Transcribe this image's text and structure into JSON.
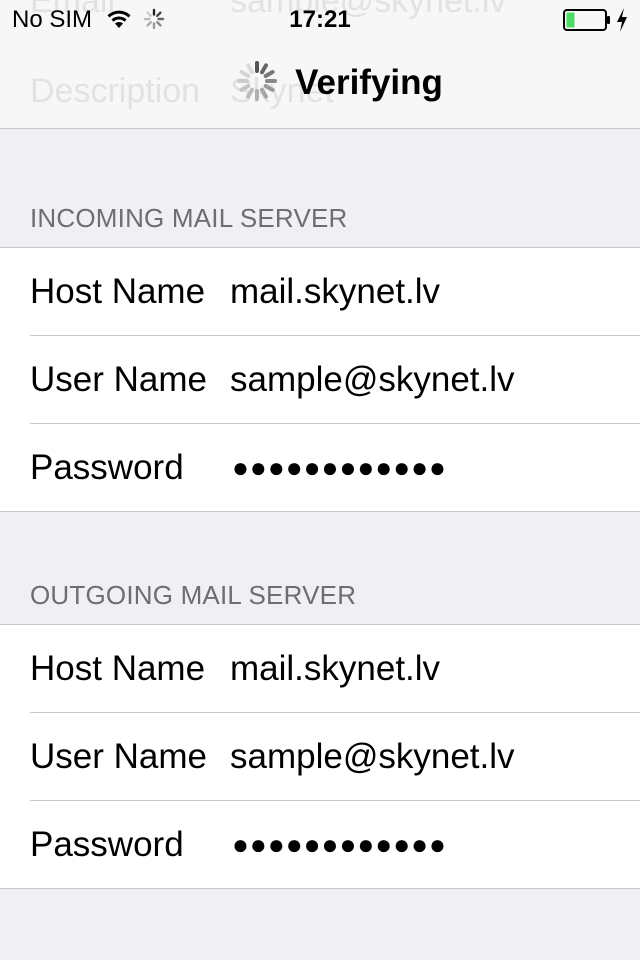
{
  "status_bar": {
    "carrier": "No SIM",
    "time": "17:21",
    "battery_color": "#4cd964",
    "icons": [
      "wifi-icon",
      "activity-spinner-icon",
      "battery-icon",
      "charging-bolt-icon"
    ]
  },
  "nav": {
    "title": "Verifying",
    "icon": "activity-spinner-icon"
  },
  "background_rows": {
    "email_label": "Email",
    "email_value": "sample@skynet.lv",
    "description_label": "Description",
    "description_value": "Skynet"
  },
  "incoming": {
    "header": "INCOMING MAIL SERVER",
    "host_label": "Host Name",
    "host_value": "mail.skynet.lv",
    "user_label": "User Name",
    "user_value": "sample@skynet.lv",
    "password_label": "Password",
    "password_value": "●●●●●●●●●●●●"
  },
  "outgoing": {
    "header": "OUTGOING MAIL SERVER",
    "host_label": "Host Name",
    "host_value": "mail.skynet.lv",
    "user_label": "User Name",
    "user_value": "sample@skynet.lv",
    "password_label": "Password",
    "password_value": "●●●●●●●●●●●●"
  }
}
